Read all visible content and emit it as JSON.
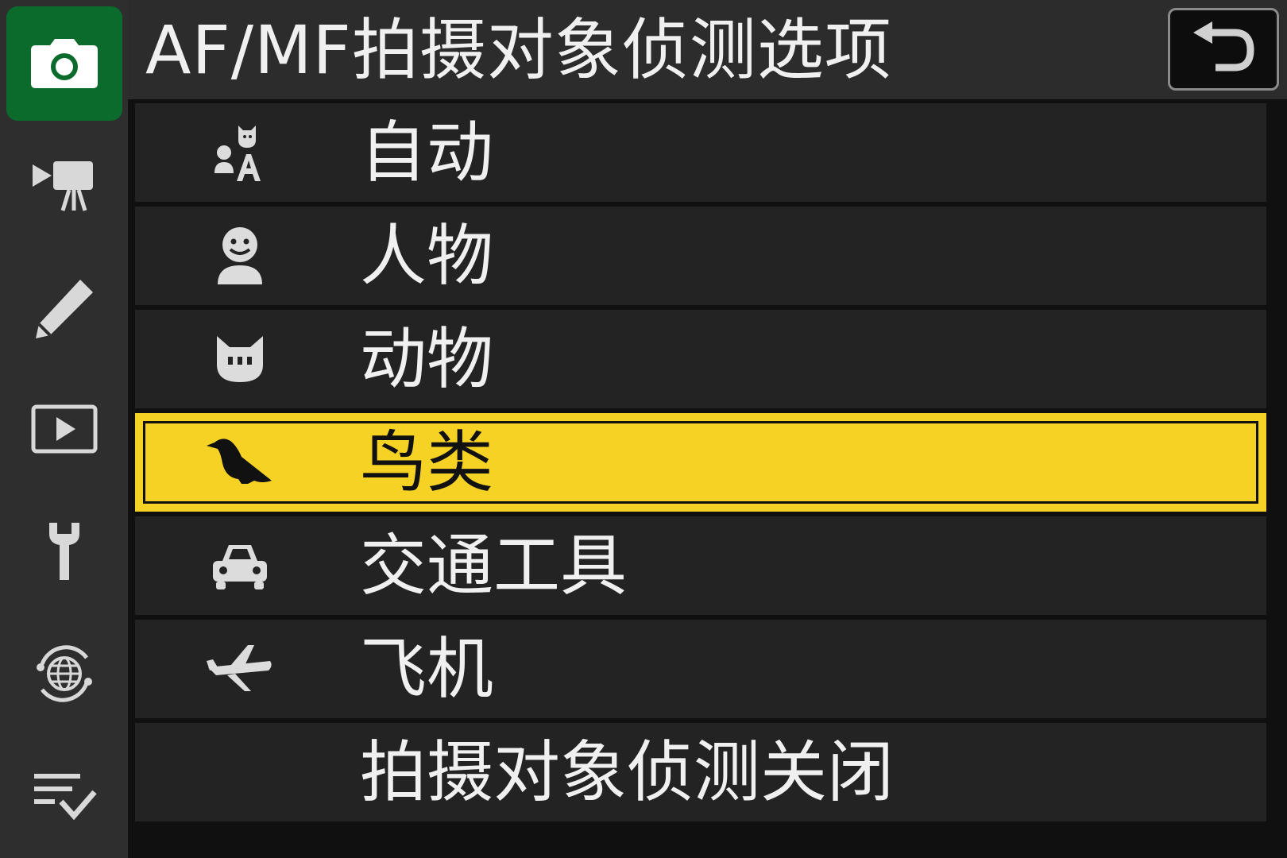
{
  "header": {
    "title": "AF/MF拍摄对象侦测选项",
    "back_icon": "return-arrow-icon"
  },
  "sidebar": {
    "tabs": [
      {
        "name": "photo-shooting-menu",
        "icon": "camera-icon",
        "active": true
      },
      {
        "name": "movie-recording-menu",
        "icon": "movie-camera-icon",
        "active": false
      },
      {
        "name": "custom-settings-menu",
        "icon": "pencil-icon",
        "active": false
      },
      {
        "name": "playback-menu",
        "icon": "play-icon",
        "active": false
      },
      {
        "name": "setup-menu",
        "icon": "wrench-icon",
        "active": false
      },
      {
        "name": "network-menu",
        "icon": "network-globe-icon",
        "active": false
      },
      {
        "name": "my-menu",
        "icon": "checklist-icon",
        "active": false
      }
    ]
  },
  "menu": {
    "selected_index": 3,
    "items": [
      {
        "label": "自动",
        "icon": "auto-subject-icon"
      },
      {
        "label": "人物",
        "icon": "person-icon"
      },
      {
        "label": "动物",
        "icon": "animal-icon"
      },
      {
        "label": "鸟类",
        "icon": "bird-icon"
      },
      {
        "label": "交通工具",
        "icon": "vehicle-icon"
      },
      {
        "label": "飞机",
        "icon": "airplane-icon"
      },
      {
        "label": "拍摄对象侦测关闭",
        "icon": ""
      }
    ]
  },
  "colors": {
    "selection": "#f5d224",
    "active_tab": "#0b6b2c",
    "row_background": "#232323",
    "sidebar_background": "#2e2e2e"
  }
}
